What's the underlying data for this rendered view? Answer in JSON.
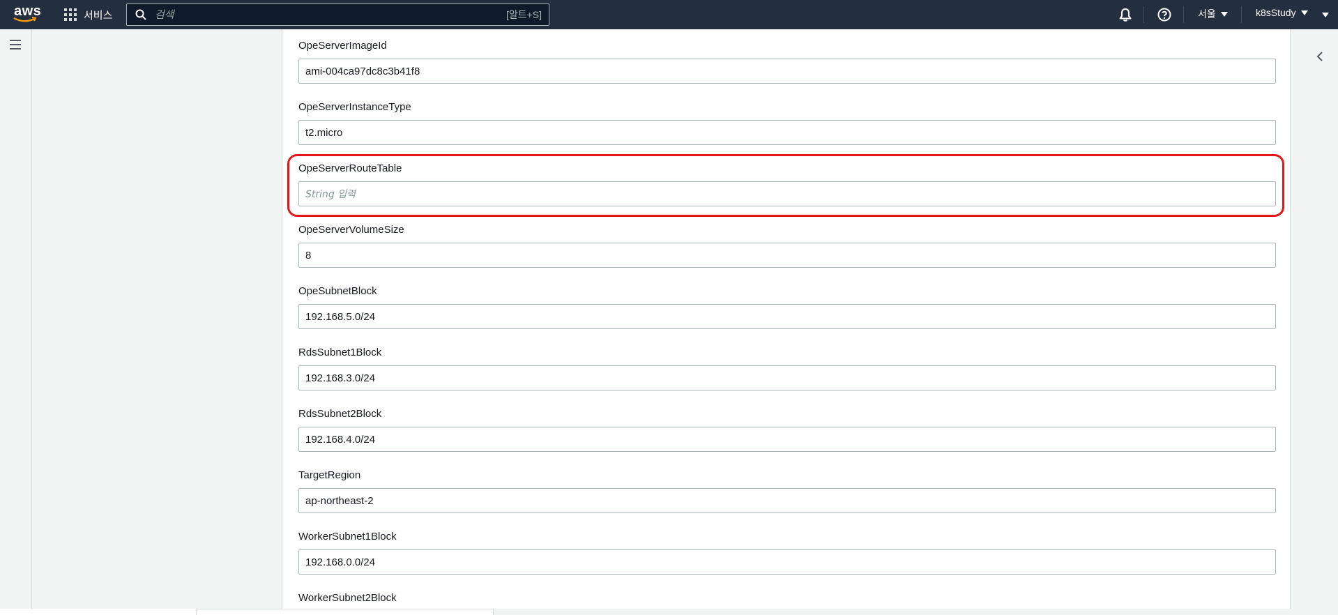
{
  "nav": {
    "logo_text": "aws",
    "services_label": "서비스",
    "search_placeholder": "검색",
    "search_shortcut": "[알트+S]",
    "region_label": "서울",
    "account_label": "k8sStudy"
  },
  "form": {
    "fields": [
      {
        "label": "OpeServerImageId",
        "value": "ami-004ca97dc8c3b41f8",
        "placeholder": ""
      },
      {
        "label": "OpeServerInstanceType",
        "value": "t2.micro",
        "placeholder": ""
      },
      {
        "label": "OpeServerRouteTable",
        "value": "",
        "placeholder": "String 입력",
        "highlighted": true
      },
      {
        "label": "OpeServerVolumeSize",
        "value": "8",
        "placeholder": ""
      },
      {
        "label": "OpeSubnetBlock",
        "value": "192.168.5.0/24",
        "placeholder": ""
      },
      {
        "label": "RdsSubnet1Block",
        "value": "192.168.3.0/24",
        "placeholder": ""
      },
      {
        "label": "RdsSubnet2Block",
        "value": "192.168.4.0/24",
        "placeholder": ""
      },
      {
        "label": "TargetRegion",
        "value": "ap-northeast-2",
        "placeholder": ""
      },
      {
        "label": "WorkerSubnet1Block",
        "value": "192.168.0.0/24",
        "placeholder": ""
      },
      {
        "label": "WorkerSubnet2Block",
        "value": "",
        "placeholder": ""
      }
    ]
  },
  "colors": {
    "nav_bg": "#232f3e",
    "highlight": "#e3161a"
  },
  "icons": [
    "aws-logo",
    "services-grid-icon",
    "search-icon",
    "bell-icon",
    "help-icon",
    "hamburger-icon",
    "collapse-icon"
  ]
}
